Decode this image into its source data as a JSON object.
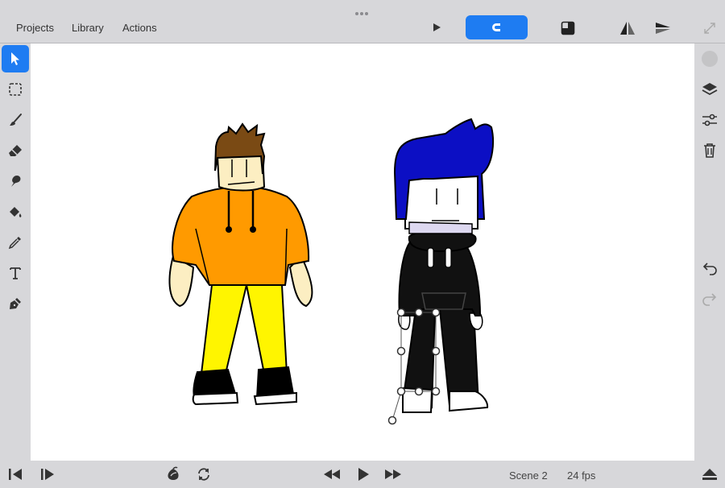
{
  "menu": {
    "projects": "Projects",
    "library": "Library",
    "actions": "Actions"
  },
  "toolbar": {
    "play_icon": "play-icon",
    "magnet_icon": "magnet-icon",
    "onion_icon": "layer-fill-icon",
    "flip_h_icon": "flip-horizontal-icon",
    "flip_v_icon": "flip-vertical-icon"
  },
  "left_tools": [
    {
      "name": "select",
      "icon": "arrow-pointer-icon",
      "active": true
    },
    {
      "name": "marquee",
      "icon": "dashed-square-icon",
      "active": false
    },
    {
      "name": "brush",
      "icon": "brush-icon",
      "active": false
    },
    {
      "name": "eraser",
      "icon": "eraser-icon",
      "active": false
    },
    {
      "name": "smudge",
      "icon": "smudge-icon",
      "active": false
    },
    {
      "name": "fill",
      "icon": "paint-bucket-icon",
      "active": false
    },
    {
      "name": "eyedropper",
      "icon": "eyedropper-icon",
      "active": false
    },
    {
      "name": "text",
      "icon": "text-icon",
      "active": false
    },
    {
      "name": "pen",
      "icon": "pen-nib-icon",
      "active": false
    }
  ],
  "right_tools": {
    "expand": "expand-icon",
    "color": "color-circle-icon",
    "layers": "layers-icon",
    "adjust": "sliders-icon",
    "delete": "trash-icon",
    "undo": "undo-icon",
    "redo": "redo-icon"
  },
  "colors": {
    "accent": "#1e7cf2",
    "chrome": "#d7d7da",
    "canvas": "#ffffff"
  },
  "bottom": {
    "scene_label": "Scene 2",
    "fps_label": "24 fps"
  }
}
